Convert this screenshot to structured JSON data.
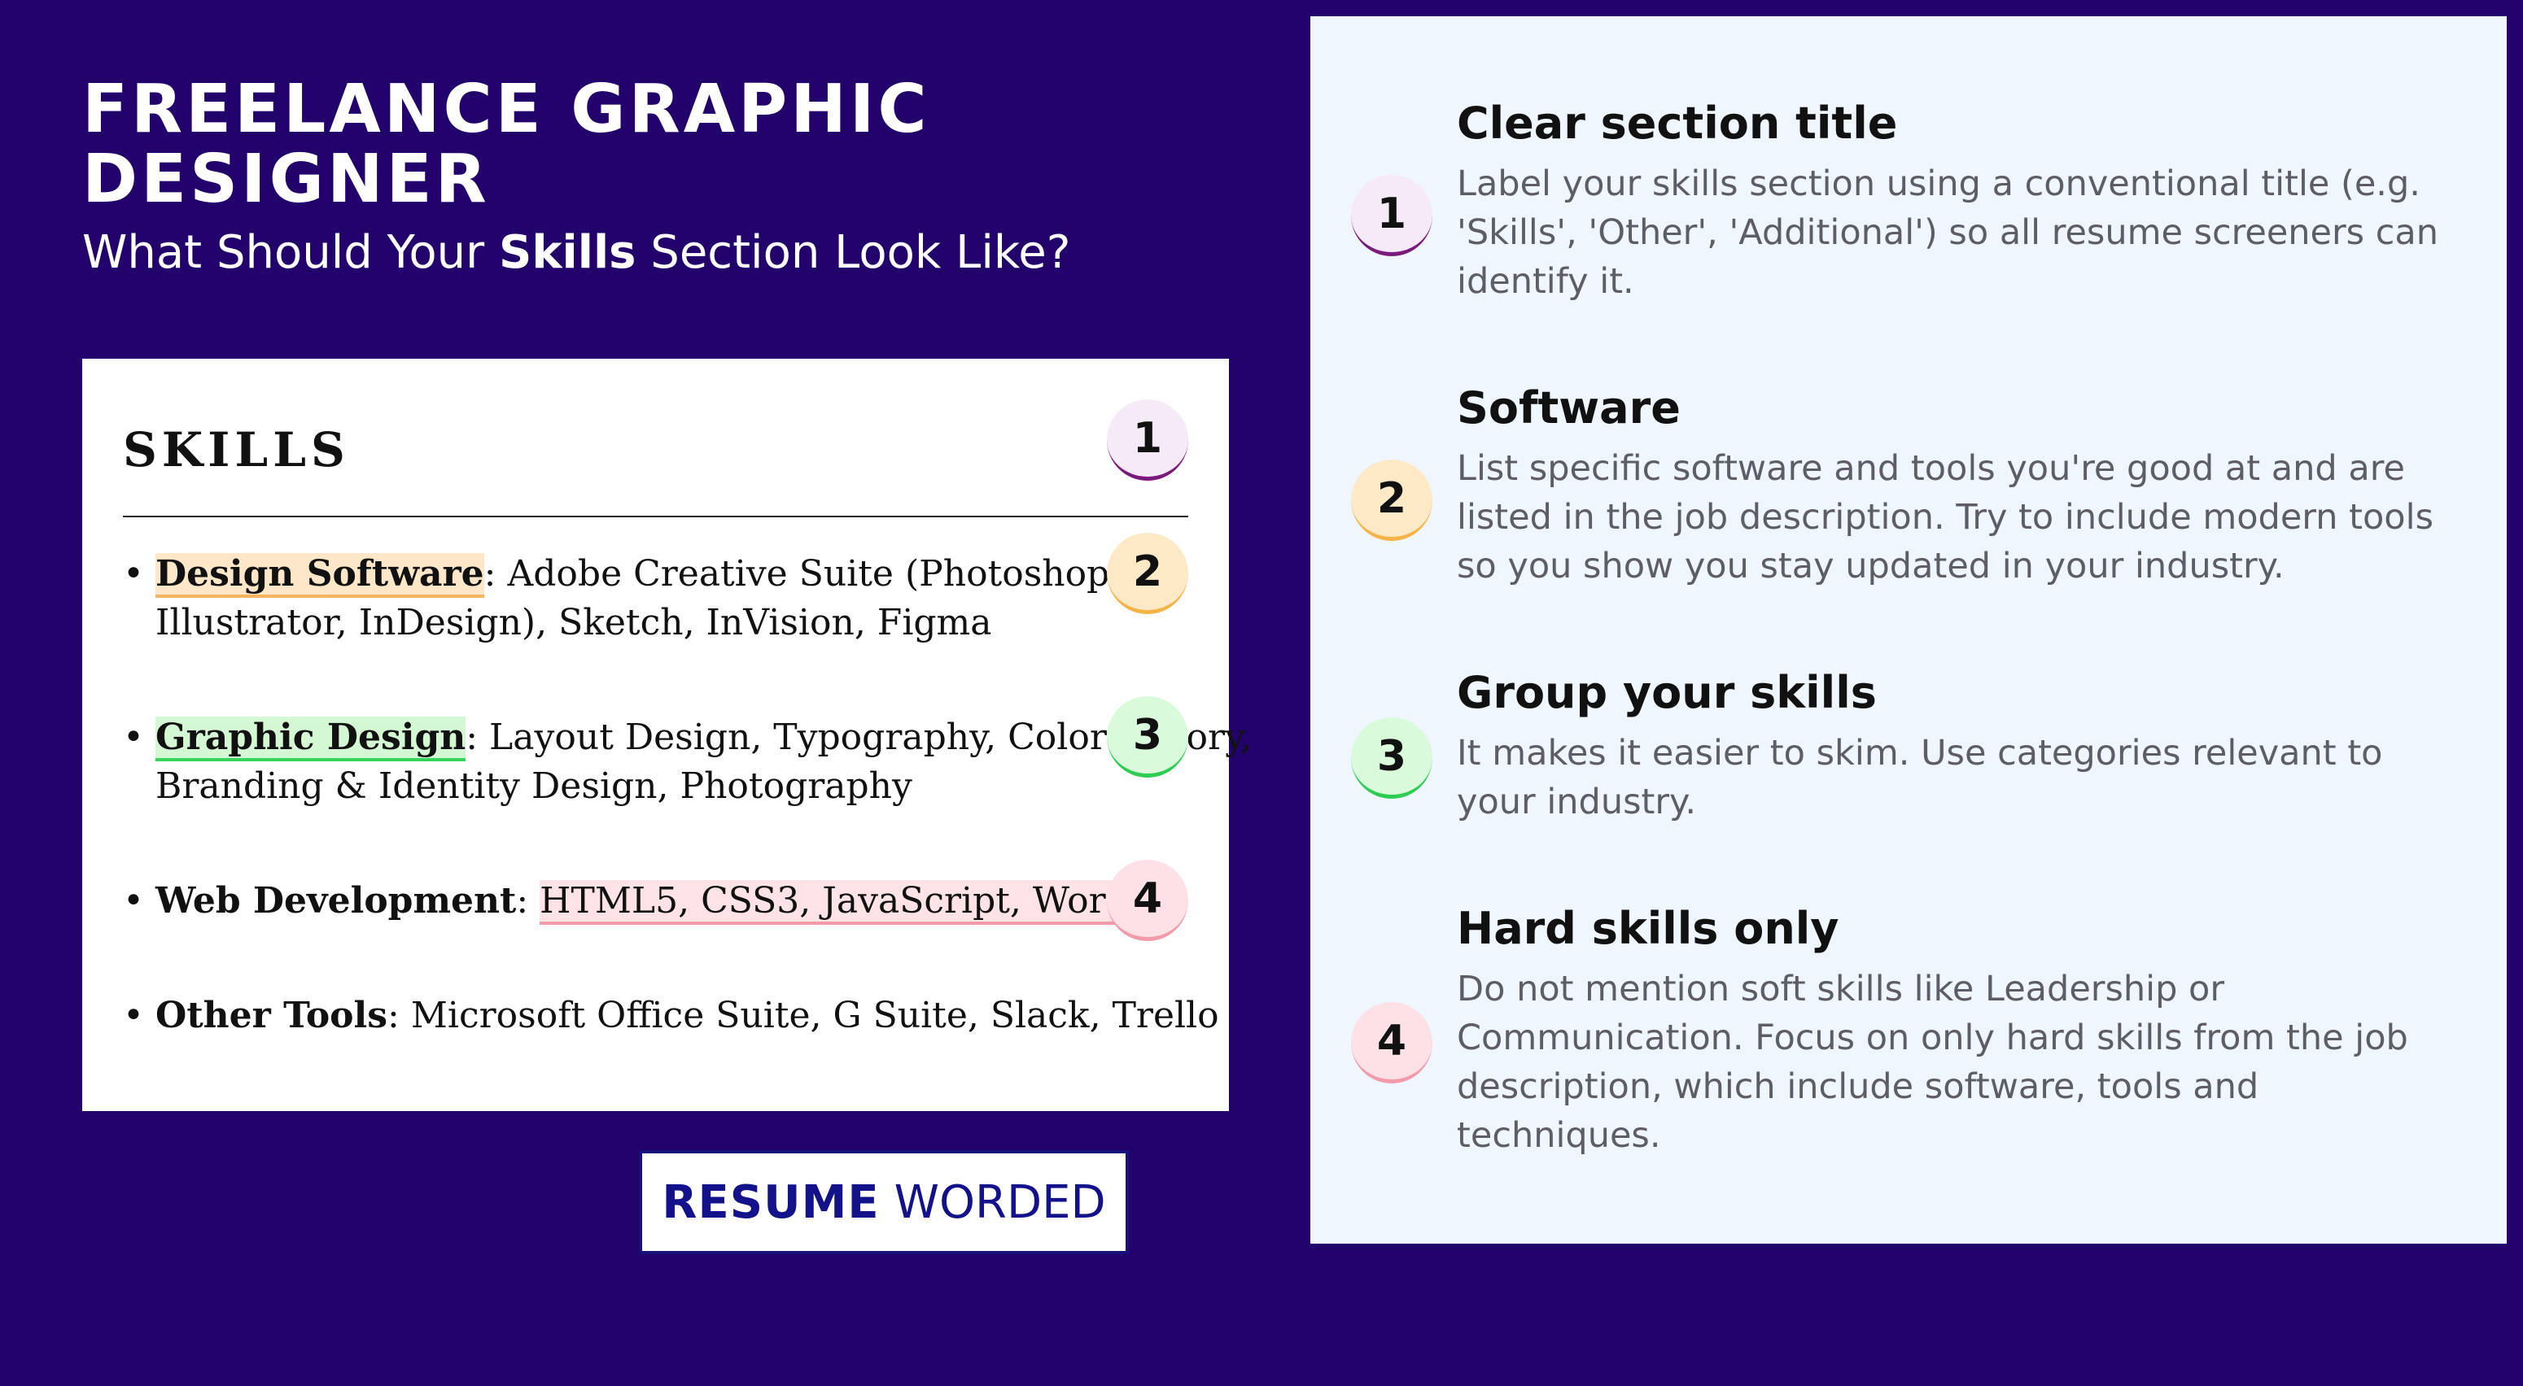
{
  "header": {
    "title_line1": "FREELANCE GRAPHIC",
    "title_line2": "DESIGNER",
    "subtitle_before": "What Should Your ",
    "subtitle_bold": "Skills",
    "subtitle_after": " Section Look Like?"
  },
  "resume": {
    "heading": "SKILLS",
    "bullet_char": "•",
    "items": [
      {
        "label": "Design Software",
        "rest_line1": ": Adobe Creative Suite (Photoshop,",
        "rest_line2": "Illustrator, InDesign), Sketch, InVision, Figma"
      },
      {
        "label": "Graphic Design",
        "rest_line1": ": Layout Design, Typography, Color Theory,",
        "rest_line2": "Branding & Identity Design, Photography"
      },
      {
        "label": "Web Development",
        "sep": ": ",
        "rest_line1": "HTML5, CSS3, JavaScript, WordPress"
      },
      {
        "label": "Other Tools",
        "rest_line1": ": Microsoft Office Suite, G Suite, Slack, Trello"
      }
    ]
  },
  "badges": [
    "1",
    "2",
    "3",
    "4"
  ],
  "brand": {
    "bold": "RESUME",
    "light": "WORDED"
  },
  "tips": [
    {
      "number": "1",
      "title": "Clear section title",
      "description": "Label your skills section using a conventional title (e.g. 'Skills', 'Other', 'Additional') so all resume screeners can identify it."
    },
    {
      "number": "2",
      "title": "Software",
      "description": "List specific software and tools you're good at and are listed in the job description. Try to include modern tools so you show you stay updated in your industry."
    },
    {
      "number": "3",
      "title": "Group your skills",
      "description": "It makes it easier to skim. Use categories relevant to your industry."
    },
    {
      "number": "4",
      "title": "Hard skills only",
      "description": "Do not mention soft skills like Leadership or Communication. Focus on only hard skills from the job description, which include software, tools and techniques."
    }
  ],
  "colors": {
    "background": "#22036b",
    "panel": "#eff6fe",
    "badge1": "#7a1a7a",
    "badge2": "#f5b348",
    "badge3": "#2ecc52",
    "badge4": "#f39aab"
  }
}
